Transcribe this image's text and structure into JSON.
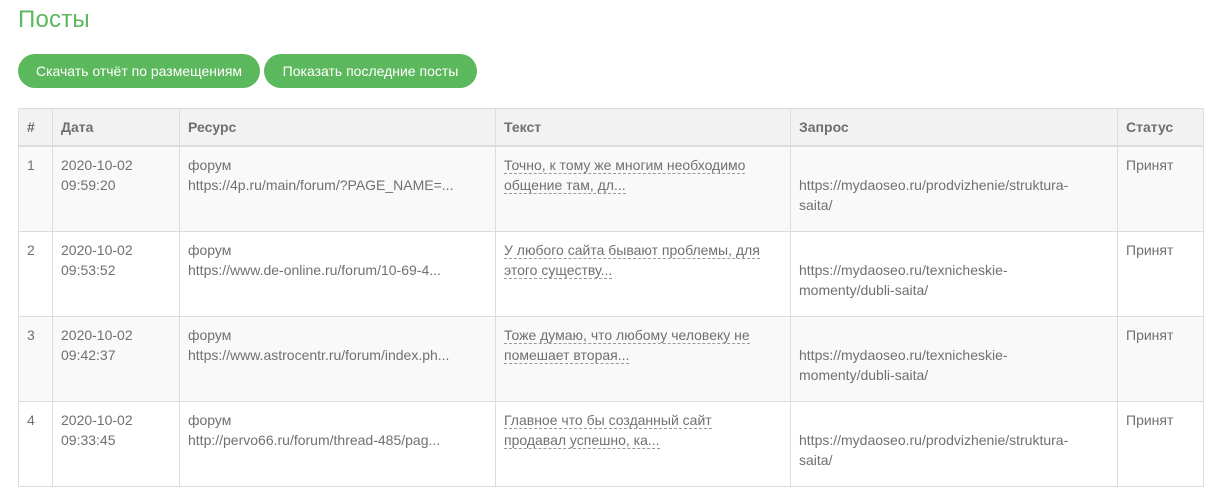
{
  "page": {
    "title": "Посты"
  },
  "actions": {
    "download_report": "Скачать отчёт по размещениям",
    "show_last_posts": "Показать последние посты"
  },
  "table": {
    "headers": {
      "num": "#",
      "date": "Дата",
      "resource": "Ресурс",
      "text": "Текст",
      "query": "Запрос",
      "status": "Статус"
    },
    "rows": [
      {
        "num": "1",
        "date": "2020-10-02",
        "time": "09:59:20",
        "resource_type": "форум",
        "resource_url": "https://4p.ru/main/forum/?PAGE_NAME=...",
        "text_line1": "Точно, к тому же многим необходимо",
        "text_line2": "общение там, дл...",
        "query_line1": "https://mydaoseo.ru/prodvizhenie/struktura-",
        "query_line2": "saita/",
        "status": "Принят"
      },
      {
        "num": "2",
        "date": "2020-10-02",
        "time": "09:53:52",
        "resource_type": "форум",
        "resource_url": "https://www.de-online.ru/forum/10-69-4...",
        "text_line1": "У любого сайта бывают проблемы, для",
        "text_line2": "этого существу...",
        "query_line1": "https://mydaoseo.ru/texnicheskie-",
        "query_line2": "momenty/dubli-saita/",
        "status": "Принят"
      },
      {
        "num": "3",
        "date": "2020-10-02",
        "time": "09:42:37",
        "resource_type": "форум",
        "resource_url": "https://www.astrocentr.ru/forum/index.ph...",
        "text_line1": "Тоже думаю, что любому человеку не",
        "text_line2": "помешает вторая...",
        "query_line1": "https://mydaoseo.ru/texnicheskie-",
        "query_line2": "momenty/dubli-saita/",
        "status": "Принят"
      },
      {
        "num": "4",
        "date": "2020-10-02",
        "time": "09:33:45",
        "resource_type": "форум",
        "resource_url": "http://pervo66.ru/forum/thread-485/pag...",
        "text_line1": "Главное что бы созданный сайт",
        "text_line2": "продавал успешно, ка...",
        "query_line1": "https://mydaoseo.ru/prodvizhenie/struktura-",
        "query_line2": "saita/",
        "status": "Принят"
      }
    ]
  },
  "colors": {
    "accent": "#5cb85c",
    "header_bg": "#f3f2f2",
    "row_odd_bg": "#f9f9f9",
    "border": "#dddddd"
  }
}
